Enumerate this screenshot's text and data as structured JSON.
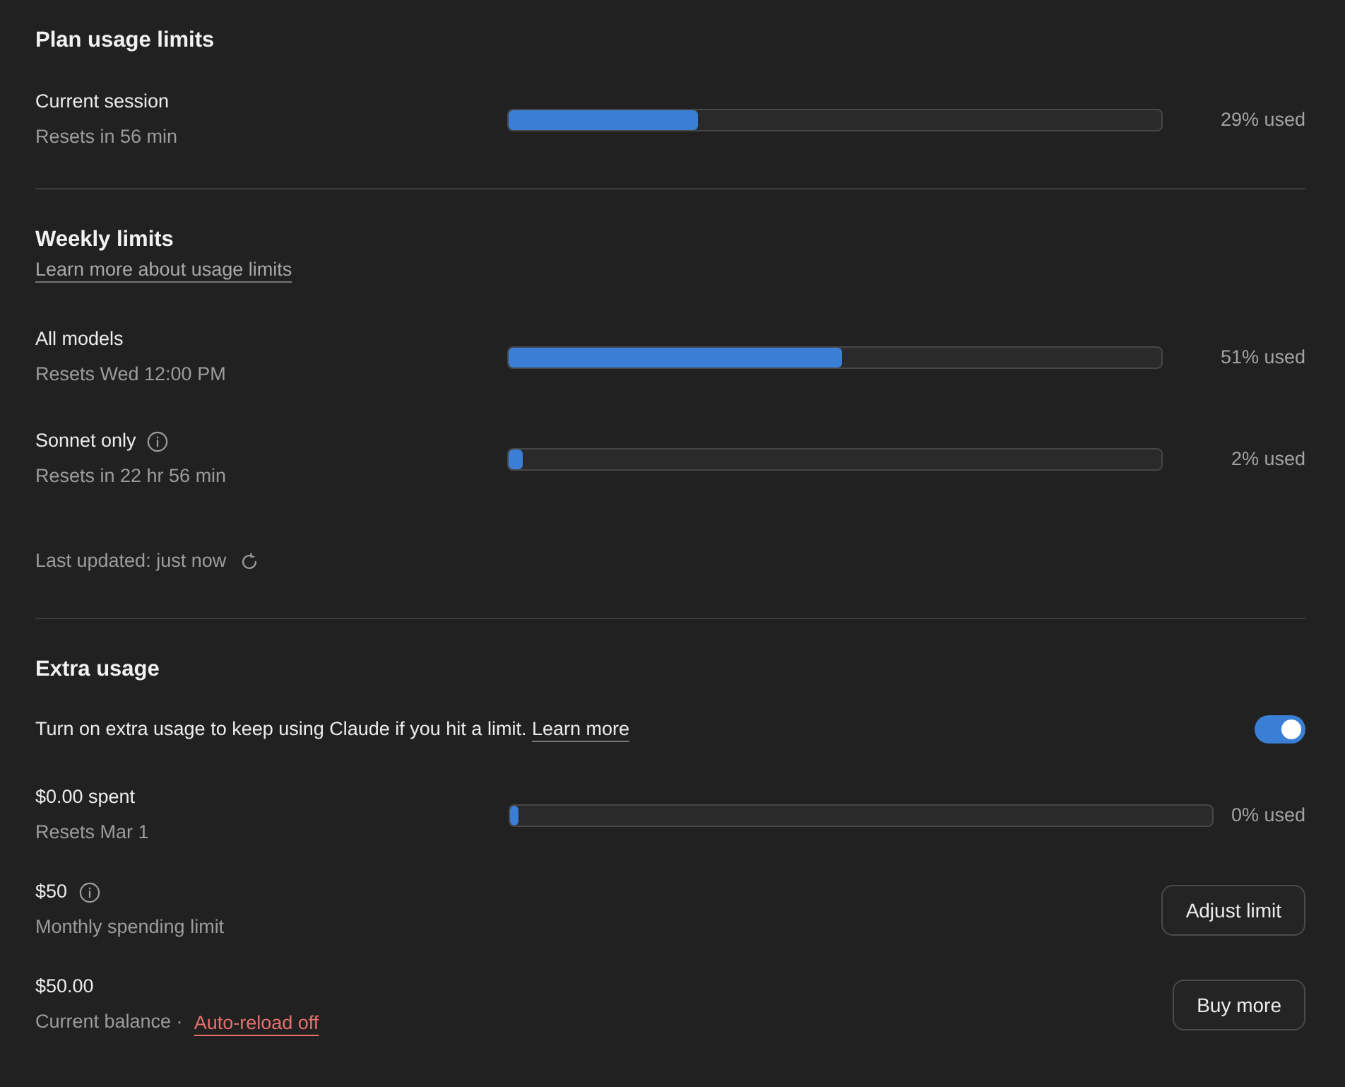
{
  "plan": {
    "title": "Plan usage limits",
    "meters": [
      {
        "label": "Current session",
        "info": false,
        "sub": "Resets in 56 min",
        "level": 0.29,
        "reading": "29% used"
      }
    ]
  },
  "weekly": {
    "title": "Weekly limits",
    "link": "Learn more about usage limits",
    "meters": [
      {
        "label": "All models",
        "info": false,
        "sub": "Resets Wed 12:00 PM",
        "level": 0.51,
        "reading": "51% used"
      },
      {
        "label": "Sonnet only",
        "info": true,
        "sub": "Resets in 22 hr 56 min",
        "level": 0.02,
        "reading": "2% used"
      }
    ],
    "updated": "Last updated: just now"
  },
  "extra": {
    "title": "Extra usage",
    "description": "Turn on extra usage to keep using Claude if you hit a limit.",
    "link": "Learn more",
    "on": true,
    "meter": {
      "label": "$0.00 spent",
      "info": false,
      "sub": "Resets Mar 1",
      "level": 0.0,
      "reading": "0% used"
    },
    "limit": {
      "amount": "$50",
      "info": true,
      "sub": "Monthly spending limit",
      "button": "Adjust limit"
    },
    "balance": {
      "amount": "$50.00",
      "info": false,
      "sub": "Current balance ·",
      "link": "Auto-reload off",
      "button": "Buy more"
    }
  }
}
